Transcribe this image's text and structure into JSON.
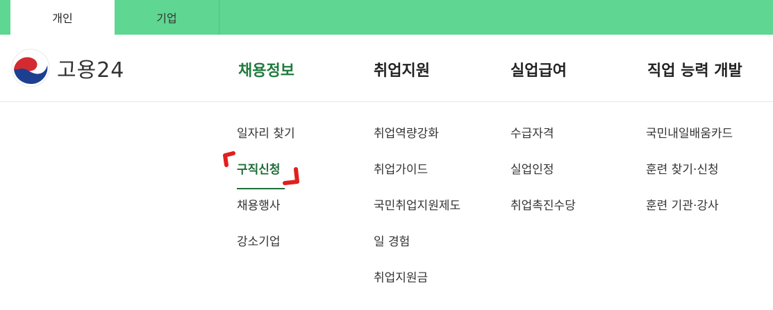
{
  "top_tabs": [
    {
      "label": "개인"
    },
    {
      "label": "기업"
    }
  ],
  "logo": {
    "text": "고용24"
  },
  "gnb": [
    {
      "label": "채용정보"
    },
    {
      "label": "취업지원"
    },
    {
      "label": "실업급여"
    },
    {
      "label": "직업 능력 개발"
    }
  ],
  "submenus": {
    "c1": [
      "일자리 찾기",
      "구직신청",
      "채용행사",
      "강소기업"
    ],
    "c2": [
      "취업역량강화",
      "취업가이드",
      "국민취업지원제도",
      "일 경험",
      "취업지원금"
    ],
    "c3": [
      "수급자격",
      "실업인정",
      "취업촉진수당"
    ],
    "c4": [
      "국민내일배움카드",
      "훈련 찾기·신청",
      "훈련 기관·강사"
    ]
  },
  "colors": {
    "top_bar": "#5fd691",
    "active_menu": "#1f7a3e",
    "annotation": "#e0201c"
  }
}
